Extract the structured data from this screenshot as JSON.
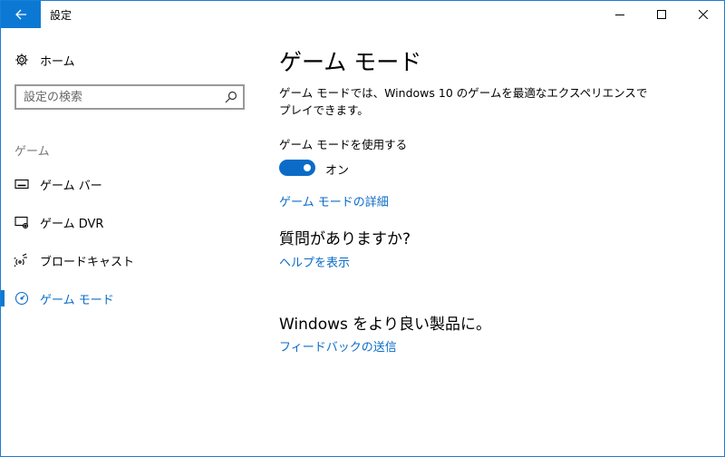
{
  "window": {
    "title": "設定",
    "accent_color": "#0b79d4"
  },
  "sidebar": {
    "home_label": "ホーム",
    "search_placeholder": "設定の検索",
    "section_title": "ゲーム",
    "items": [
      {
        "label": "ゲーム バー",
        "icon": "game-bar-icon",
        "active": false
      },
      {
        "label": "ゲーム DVR",
        "icon": "game-dvr-icon",
        "active": false
      },
      {
        "label": "ブロードキャスト",
        "icon": "broadcast-icon",
        "active": false
      },
      {
        "label": "ゲーム モード",
        "icon": "game-mode-icon",
        "active": true
      }
    ]
  },
  "main": {
    "title": "ゲーム モード",
    "description": "ゲーム モードでは、Windows 10 のゲームを最適なエクスペリエンスでプレイできます。",
    "toggle_label": "ゲーム モードを使用する",
    "toggle_state": "オン",
    "toggle_on": true,
    "details_link": "ゲーム モードの詳細",
    "question_title": "質問がありますか?",
    "help_link": "ヘルプを表示",
    "feedback_title": "Windows をより良い製品に。",
    "feedback_link": "フィードバックの送信"
  }
}
